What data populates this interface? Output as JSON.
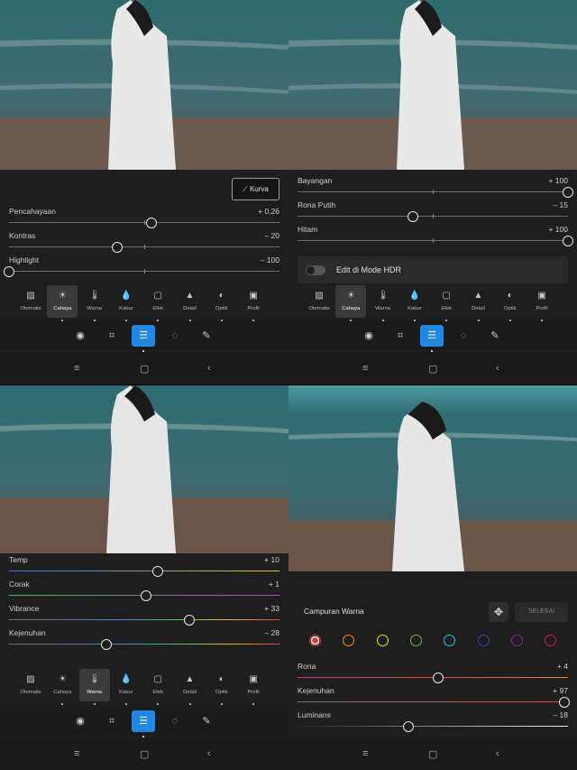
{
  "panel1": {
    "curve_label": "Kurva",
    "sliders": [
      {
        "label": "Pencahayaan",
        "value": "+ 0,26",
        "pos": 0.525
      },
      {
        "label": "Kontras",
        "value": "– 20",
        "pos": 0.4
      },
      {
        "label": "Highlight",
        "value": "– 100",
        "pos": 0.0
      }
    ]
  },
  "panel2": {
    "sliders": [
      {
        "label": "Bayangan",
        "value": "+ 100",
        "pos": 1.0
      },
      {
        "label": "Rona Putih",
        "value": "– 15",
        "pos": 0.425
      },
      {
        "label": "Hitam",
        "value": "+ 100",
        "pos": 1.0
      }
    ],
    "hdr_label": "Edit di Mode HDR"
  },
  "panel3": {
    "sliders": [
      {
        "label": "Temp",
        "value": "+ 10",
        "pos": 0.55
      },
      {
        "label": "Corak",
        "value": "+ 1",
        "pos": 0.505
      },
      {
        "label": "Vibrance",
        "value": "+ 33",
        "pos": 0.665
      },
      {
        "label": "Kejenuhan",
        "value": "– 28",
        "pos": 0.36
      }
    ]
  },
  "panel4": {
    "title": "Campuran Warna",
    "done_label": "SELESAI",
    "colors": [
      "#e53935",
      "#fb8c00",
      "#fdd835",
      "#7cb342",
      "#26c6da",
      "#3949ab",
      "#8e24aa",
      "#d81b60"
    ],
    "sliders": [
      {
        "label": "Rona",
        "value": "+ 4",
        "pos": 0.52
      },
      {
        "label": "Kejenuhan",
        "value": "+ 97",
        "pos": 0.985
      },
      {
        "label": "Luminans",
        "value": "– 18",
        "pos": 0.41
      }
    ]
  },
  "tabs": [
    {
      "label": "Otomatis",
      "icon": "auto-icon"
    },
    {
      "label": "Cahaya",
      "icon": "sun-icon"
    },
    {
      "label": "Warna",
      "icon": "thermometer-icon"
    },
    {
      "label": "Kabur",
      "icon": "blur-icon"
    },
    {
      "label": "Efek",
      "icon": "effects-icon"
    },
    {
      "label": "Detail",
      "icon": "detail-icon"
    },
    {
      "label": "Optik",
      "icon": "optics-icon"
    },
    {
      "label": "Profil",
      "icon": "profile-icon"
    }
  ],
  "tools": [
    "presets-icon",
    "crop-icon",
    "adjust-icon",
    "masking-icon",
    "healing-icon"
  ],
  "colors": {
    "accent": "#1e88e5",
    "panel_bg": "#1e1e1e"
  }
}
